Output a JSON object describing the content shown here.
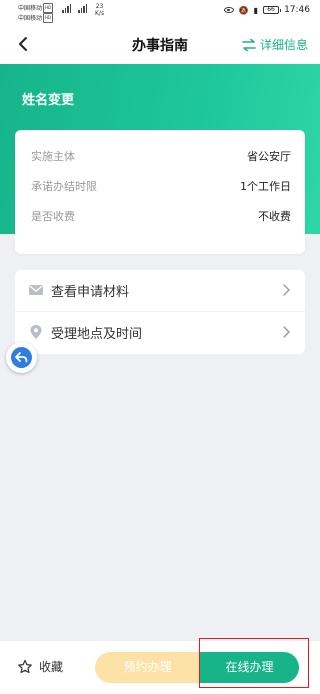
{
  "statusbar": {
    "carrier1": "中国移动",
    "carrier2": "中国移动",
    "hd": "HD",
    "net": "4G",
    "speed_value": "23",
    "speed_unit": "K/s",
    "battery": "66",
    "time": "17:46"
  },
  "navbar": {
    "title": "办事指南",
    "detail_label": "详细信息"
  },
  "hero": {
    "title": "姓名变更"
  },
  "info": [
    {
      "key": "实施主体",
      "value": "省公安厅"
    },
    {
      "key": "承诺办结时限",
      "value": "1个工作日"
    },
    {
      "key": "是否收费",
      "value": "不收费"
    }
  ],
  "list": [
    {
      "label": "查看申请材料",
      "icon": "mail-icon"
    },
    {
      "label": "受理地点及时间",
      "icon": "location-icon"
    }
  ],
  "bottom": {
    "favorite_label": "收藏",
    "reserve_label": "预约办理",
    "online_label": "在线办理"
  },
  "colors": {
    "accent": "#17b48a",
    "reserve": "#fde2a7",
    "highlight": "#e21b1b",
    "float_button": "#2f7de1"
  }
}
